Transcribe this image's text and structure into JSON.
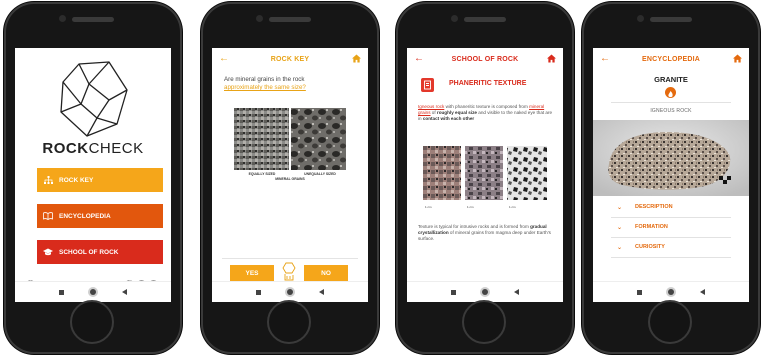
{
  "colors": {
    "accent_orange": "#e46a0e",
    "rock_key": "#f5a61a",
    "encyclopedia": "#e2570d",
    "school": "#d92b1c"
  },
  "screen1": {
    "brand_bold": "ROCK",
    "brand_light": "CHECK",
    "menu": [
      {
        "label": "ROCK KEY",
        "icon": "hierarchy-icon"
      },
      {
        "label": "ENCYCLOPEDIA",
        "icon": "book-icon"
      },
      {
        "label": "SCHOOL OF ROCK",
        "icon": "graduation-cap-icon"
      }
    ],
    "info_glyph": "i"
  },
  "screen2": {
    "title": "ROCK KEY",
    "question_plain": "Are mineral grains in the rock",
    "question_link": "approximately the same size?",
    "caption_left": "EQUALLY SIZED",
    "caption_right": "UNEQUALLY SIZED",
    "caption_bottom": "MINERAL GRAINS",
    "yes_label": "YES",
    "no_label": "NO"
  },
  "screen3": {
    "title": "SCHOOL OF ROCK",
    "section_title": "PHANERITIC TEXTURE",
    "p1": {
      "link1": "Igneous rock",
      "t1": " with phaneritic texture is composed from ",
      "link2": "mineral grains",
      "t2": " of ",
      "b1": "roughly equal size",
      "t3": " and visible to the naked eye that are in ",
      "b2": "contact with each other"
    },
    "scale_labels": [
      "1 cm",
      "1 cm",
      "1 cm"
    ],
    "p2": {
      "t1": "Texture is typical for intrusive rocks and is formed from ",
      "b1": "gradual crystallization",
      "t2": " of mineral grains from magma deep under Earth's surface."
    }
  },
  "screen4": {
    "title": "ENCYCLOPEDIA",
    "rock_name": "GRANITE",
    "rock_type": "IGNEOUS ROCK",
    "sections": [
      "DESCRIPTION",
      "FORMATION",
      "CURIOSITY"
    ]
  }
}
